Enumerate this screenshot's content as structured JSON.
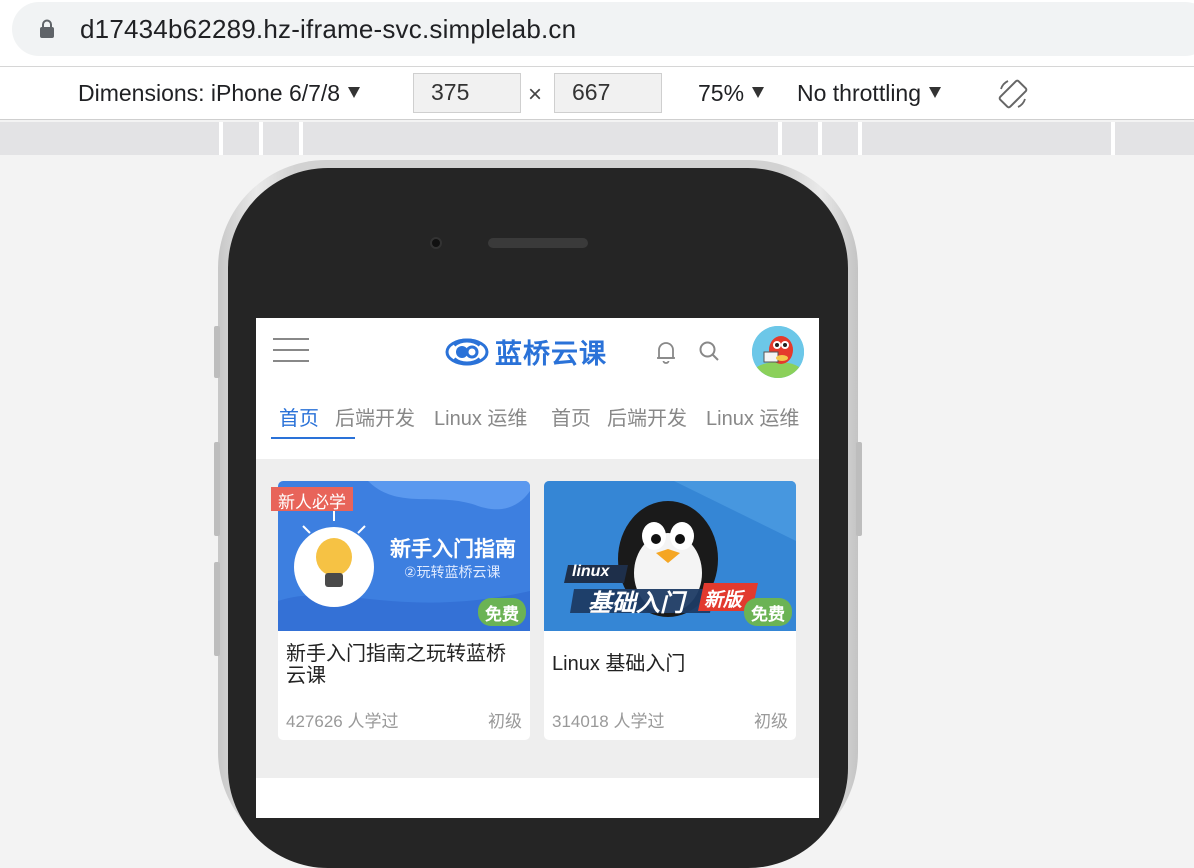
{
  "browser": {
    "url": "d17434b62289.hz-iframe-svc.simplelab.cn"
  },
  "device_toolbar": {
    "dimensions_label": "Dimensions: iPhone 6/7/8",
    "width_value": "375",
    "height_value": "667",
    "times": "×",
    "zoom": "75%",
    "throttling": "No throttling"
  },
  "app": {
    "logo_text": "蓝桥云课",
    "tabs": [
      "首页",
      "后端开发",
      "Linux 运维",
      "首页",
      "后端开发",
      "Linux 运维"
    ],
    "active_tab": 0,
    "courses": [
      {
        "thumb_headline": "新手入门指南",
        "thumb_sub": "②玩转蓝桥云课",
        "new_tag": "新人必学",
        "free_badge": "免费",
        "title": "新手入门指南之玩转蓝桥云课",
        "learners": "427626 人学过",
        "level": "初级"
      },
      {
        "thumb_tag": "linux",
        "thumb_headline": "基础入门",
        "thumb_new": "新版",
        "free_badge": "免费",
        "title": "Linux 基础入门",
        "learners": "314018 人学过",
        "level": "初级"
      }
    ]
  },
  "colors": {
    "accent": "#2a72d8",
    "free_badge": "#6bb354",
    "new_tag": "#e8645a"
  }
}
